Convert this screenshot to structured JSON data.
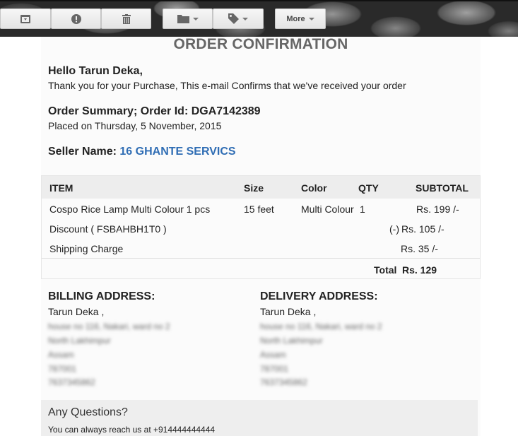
{
  "toolbar": {
    "archive_icon": "archive-icon",
    "spam_icon": "report-spam-icon",
    "delete_icon": "trash-icon",
    "move_icon": "folder-icon",
    "labels_icon": "tag-icon",
    "more_label": "More"
  },
  "email": {
    "title": "ORDER CONFIRMATION",
    "greeting": "Hello Tarun Deka,",
    "intro": "Thank you for your Purchase, This e-mail Confirms that we've received your order",
    "order_summary": "Order Summary; Order Id: DGA7142389",
    "placed_on": "Placed on Thursday, 5 November, 2015",
    "seller_label": "Seller Name:",
    "seller_name": "16 GHANTE SERVICS"
  },
  "table": {
    "headers": {
      "item": "ITEM",
      "size": "Size",
      "color": "Color",
      "qty": "QTY",
      "subtotal": "SUBTOTAL"
    },
    "row": {
      "item": "Cospo Rice Lamp Multi Colour 1 pcs",
      "size": "15 feet",
      "color": "Multi Colour",
      "qty": "1",
      "subtotal": "Rs. 199 /-"
    },
    "discount_label": "Discount ( FSBAHBH1T0 )",
    "discount_prefix": "(-)",
    "discount_value": "Rs. 105 /-",
    "shipping_label": "Shipping Charge",
    "shipping_value": "Rs. 35 /-",
    "total_label": "Total",
    "total_value": "Rs. 129"
  },
  "billing": {
    "heading": "BILLING ADDRESS:",
    "name": "Tarun Deka ,",
    "lines": [
      "house no 116, Nakari, ward no 2",
      "North Lakhimpur",
      "Assam",
      "787001",
      "7637345862"
    ]
  },
  "delivery": {
    "heading": "DELIVERY ADDRESS:",
    "name": "Tarun Deka ,",
    "lines": [
      "house no 116, Nakari, ward no 2",
      "North Lakhimpur",
      "Assam",
      "787001",
      "7637345862"
    ]
  },
  "questions": {
    "heading": "Any Questions?",
    "text": "You can always reach us at +914444444444"
  }
}
